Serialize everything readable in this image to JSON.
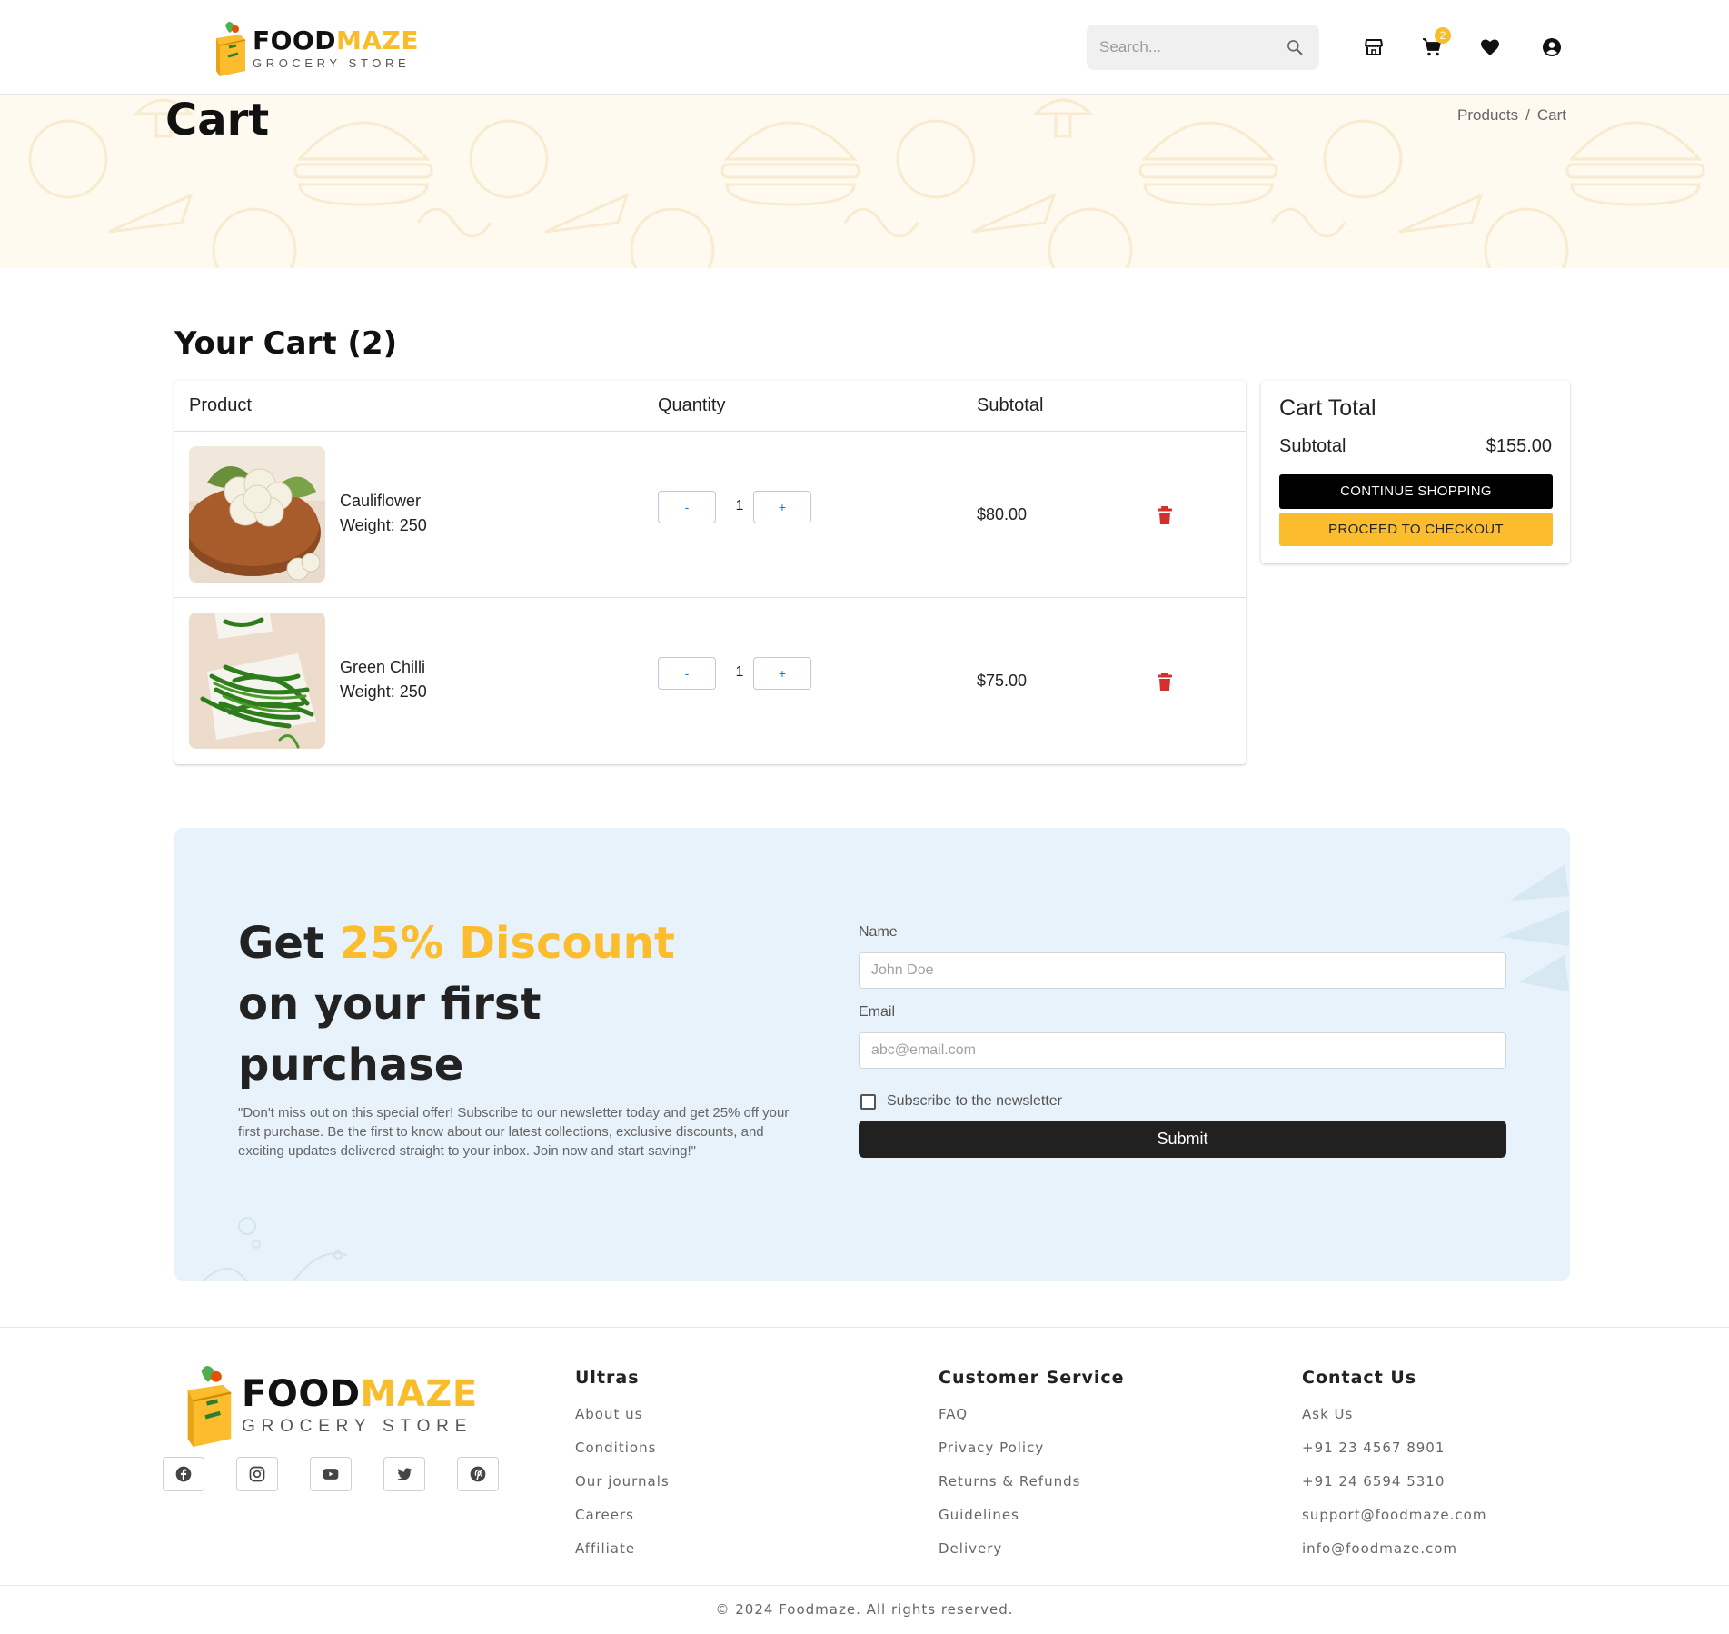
{
  "brand": {
    "name_part1": "FOOD",
    "name_part2": "MAZE",
    "tagline": "GROCERY STORE"
  },
  "header": {
    "search_placeholder": "Search...",
    "cart_count": "2",
    "icons": [
      "store-icon",
      "cart-icon",
      "heart-icon",
      "account-icon"
    ]
  },
  "banner": {
    "title": "Cart",
    "breadcrumb": [
      "Products",
      "Cart"
    ]
  },
  "cart": {
    "heading": "Your Cart (2)",
    "columns": [
      "Product",
      "Quantity",
      "Subtotal"
    ],
    "items": [
      {
        "name": "Cauliflower",
        "weight": "Weight: 250",
        "quantity": "1",
        "subtotal": "$80.00",
        "minus": "-",
        "plus": "+"
      },
      {
        "name": "Green Chilli",
        "weight": "Weight: 250",
        "quantity": "1",
        "subtotal": "$75.00",
        "minus": "-",
        "plus": "+"
      }
    ]
  },
  "cart_total": {
    "title": "Cart Total",
    "subtotal_label": "Subtotal",
    "subtotal_value": "$155.00",
    "continue_label": "CONTINUE SHOPPING",
    "checkout_label": "PROCEED TO CHECKOUT"
  },
  "promo": {
    "headline_pre": "Get ",
    "headline_highlight": "25% Discount",
    "headline_post": "on your first purchase",
    "description": "\"Don't miss out on this special offer! Subscribe to our newsletter today and get 25% off your first purchase. Be the first to know about our latest collections, exclusive discounts, and exciting updates delivered straight to your inbox. Join now and start saving!\"",
    "name_label": "Name",
    "name_placeholder": "John Doe",
    "email_label": "Email",
    "email_placeholder": "abc@email.com",
    "subscribe_label": "Subscribe to the newsletter",
    "submit_label": "Submit"
  },
  "footer": {
    "socials": [
      "facebook-icon",
      "instagram-icon",
      "youtube-icon",
      "twitter-icon",
      "pinterest-icon"
    ],
    "columns": [
      {
        "title": "Ultras",
        "links": [
          "About us",
          "Conditions",
          "Our journals",
          "Careers",
          "Affiliate"
        ]
      },
      {
        "title": "Customer Service",
        "links": [
          "FAQ",
          "Privacy Policy",
          "Returns & Refunds",
          "Guidelines",
          "Delivery"
        ]
      },
      {
        "title": "Contact Us",
        "links": [
          "Ask Us",
          "+91 23 4567 8901",
          "+91 24 6594 5310",
          "support@foodmaze.com",
          "info@foodmaze.com"
        ]
      }
    ],
    "copyright": "© 2024 Foodmaze. All rights reserved."
  },
  "colors": {
    "accent": "#fbbd2e",
    "danger": "#d32f2f",
    "banner_bg": "#fffaf0",
    "promo_bg": "#e7f2fa"
  }
}
